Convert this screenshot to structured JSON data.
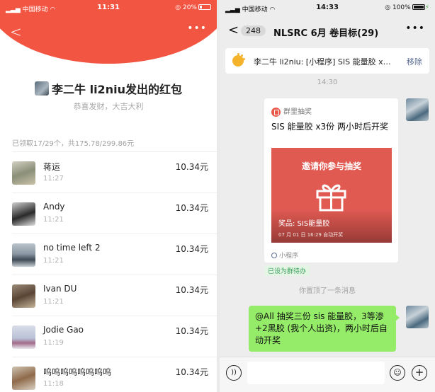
{
  "left": {
    "status": {
      "carrier": "中国移动",
      "time": "11:31",
      "battery": "20%"
    },
    "sender": "李二牛 li2niu发出的红包",
    "blessing": "恭喜发财，大吉大利",
    "summary": "已领取17/29个，共175.78/299.86元",
    "recipients": [
      {
        "name": "蒋运",
        "time": "11:27",
        "amount": "10.34元"
      },
      {
        "name": "Andy",
        "time": "11:21",
        "amount": "10.34元"
      },
      {
        "name": "no time left 2",
        "time": "11:21",
        "amount": "10.34元"
      },
      {
        "name": "Ivan DU",
        "time": "11:21",
        "amount": "10.34元"
      },
      {
        "name": "Jodie Gao",
        "time": "11:19",
        "amount": "10.34元"
      },
      {
        "name": "呜呜呜呜呜呜呜呜",
        "time": "11:18",
        "amount": "10.34元"
      }
    ]
  },
  "right": {
    "status": {
      "carrier": "中国移动",
      "time": "14:33",
      "battery": "100%"
    },
    "nav": {
      "back_count": "248",
      "title": "NLSRC 6月 卷目标(29)"
    },
    "pinned": {
      "text": "李二牛 li2niu: [小程序] SIS 能量胶 x3份 两小时后开奖",
      "remove": "移除"
    },
    "time1": "14:30",
    "mini_program": {
      "source": "群里抽奖",
      "title": "SIS 能量胶 x3份 两小时后开奖",
      "banner": "邀请你参与抽奖",
      "prize": "奖品: SIS能量胶",
      "draw_time": "07 月 01 日 16:29 自动开奖",
      "footer": "小程序"
    },
    "todo_tag": "已设为群待办",
    "pin_notice": "你置顶了一条消息",
    "my_message": "@All 抽奖三份 sis 能量胶，3等渗+2黑胶 (我个人出资)，两小时后自动开奖"
  }
}
